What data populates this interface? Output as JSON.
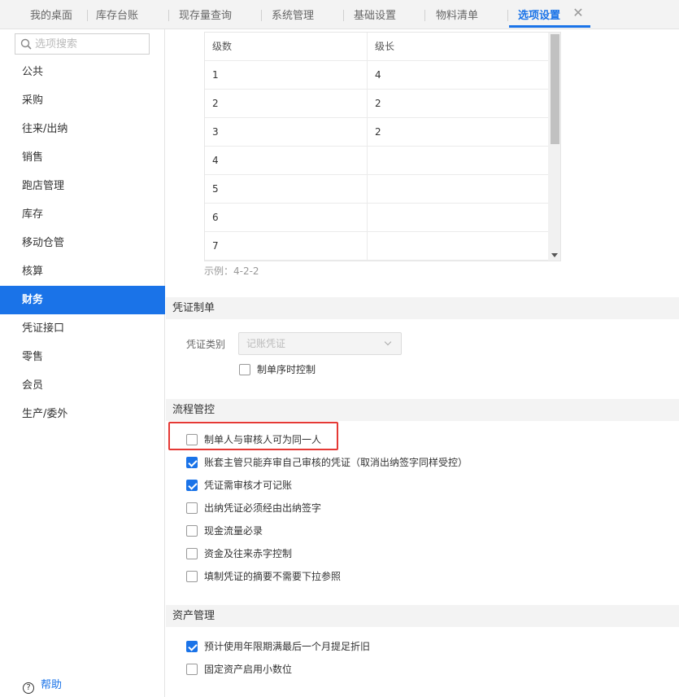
{
  "tabs": [
    {
      "label": "我的桌面"
    },
    {
      "label": "库存台账"
    },
    {
      "label": "现存量查询"
    },
    {
      "label": "系统管理"
    },
    {
      "label": "基础设置"
    },
    {
      "label": "物料清单"
    },
    {
      "label": "选项设置",
      "active": true
    }
  ],
  "sidebar": {
    "search_placeholder": "选项搜索",
    "items": [
      {
        "label": "公共"
      },
      {
        "label": "采购"
      },
      {
        "label": "往来/出纳"
      },
      {
        "label": "销售"
      },
      {
        "label": "跑店管理"
      },
      {
        "label": "库存"
      },
      {
        "label": "移动仓管"
      },
      {
        "label": "核算"
      },
      {
        "label": "财务",
        "active": true
      },
      {
        "label": "凭证接口"
      },
      {
        "label": "零售"
      },
      {
        "label": "会员"
      },
      {
        "label": "生产/委外"
      }
    ],
    "help_label": "帮助"
  },
  "level_table": {
    "headers": [
      "级数",
      "级长"
    ],
    "rows": [
      [
        "1",
        "4"
      ],
      [
        "2",
        "2"
      ],
      [
        "3",
        "2"
      ],
      [
        "4",
        ""
      ],
      [
        "5",
        ""
      ],
      [
        "6",
        ""
      ],
      [
        "7",
        ""
      ]
    ],
    "example": "示例：4-2-2"
  },
  "voucher_section": {
    "title": "凭证制单",
    "type_label": "凭证类别",
    "type_value": "记账凭证",
    "sequence_control": {
      "label": "制单序时控制",
      "checked": false
    }
  },
  "process_section": {
    "title": "流程管控",
    "options": [
      {
        "label": "制单人与审核人可为同一人",
        "checked": false
      },
      {
        "label": "账套主管只能弃审自己审核的凭证（取消出纳签字同样受控）",
        "checked": true
      },
      {
        "label": "凭证需审核才可记账",
        "checked": true
      },
      {
        "label": "出纳凭证必须经由出纳签字",
        "checked": false
      },
      {
        "label": "现金流量必录",
        "checked": false
      },
      {
        "label": "资金及往来赤字控制",
        "checked": false
      },
      {
        "label": "填制凭证的摘要不需要下拉参照",
        "checked": false
      }
    ]
  },
  "asset_section": {
    "title": "资产管理",
    "options": [
      {
        "label": "预计使用年限期满最后一个月提足折旧",
        "checked": true
      },
      {
        "label": "固定资产启用小数位",
        "checked": false
      }
    ]
  },
  "colors": {
    "accent": "#1a73e8",
    "highlight": "#e53935"
  }
}
